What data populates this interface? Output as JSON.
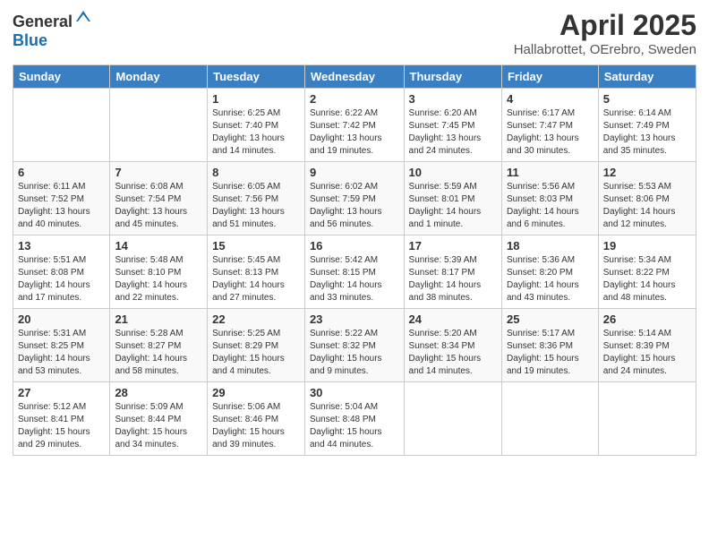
{
  "header": {
    "logo_general": "General",
    "logo_blue": "Blue",
    "title": "April 2025",
    "subtitle": "Hallabrottet, OErebro, Sweden"
  },
  "weekdays": [
    "Sunday",
    "Monday",
    "Tuesday",
    "Wednesday",
    "Thursday",
    "Friday",
    "Saturday"
  ],
  "weeks": [
    [
      {
        "num": "",
        "info": ""
      },
      {
        "num": "",
        "info": ""
      },
      {
        "num": "1",
        "info": "Sunrise: 6:25 AM\nSunset: 7:40 PM\nDaylight: 13 hours and 14 minutes."
      },
      {
        "num": "2",
        "info": "Sunrise: 6:22 AM\nSunset: 7:42 PM\nDaylight: 13 hours and 19 minutes."
      },
      {
        "num": "3",
        "info": "Sunrise: 6:20 AM\nSunset: 7:45 PM\nDaylight: 13 hours and 24 minutes."
      },
      {
        "num": "4",
        "info": "Sunrise: 6:17 AM\nSunset: 7:47 PM\nDaylight: 13 hours and 30 minutes."
      },
      {
        "num": "5",
        "info": "Sunrise: 6:14 AM\nSunset: 7:49 PM\nDaylight: 13 hours and 35 minutes."
      }
    ],
    [
      {
        "num": "6",
        "info": "Sunrise: 6:11 AM\nSunset: 7:52 PM\nDaylight: 13 hours and 40 minutes."
      },
      {
        "num": "7",
        "info": "Sunrise: 6:08 AM\nSunset: 7:54 PM\nDaylight: 13 hours and 45 minutes."
      },
      {
        "num": "8",
        "info": "Sunrise: 6:05 AM\nSunset: 7:56 PM\nDaylight: 13 hours and 51 minutes."
      },
      {
        "num": "9",
        "info": "Sunrise: 6:02 AM\nSunset: 7:59 PM\nDaylight: 13 hours and 56 minutes."
      },
      {
        "num": "10",
        "info": "Sunrise: 5:59 AM\nSunset: 8:01 PM\nDaylight: 14 hours and 1 minute."
      },
      {
        "num": "11",
        "info": "Sunrise: 5:56 AM\nSunset: 8:03 PM\nDaylight: 14 hours and 6 minutes."
      },
      {
        "num": "12",
        "info": "Sunrise: 5:53 AM\nSunset: 8:06 PM\nDaylight: 14 hours and 12 minutes."
      }
    ],
    [
      {
        "num": "13",
        "info": "Sunrise: 5:51 AM\nSunset: 8:08 PM\nDaylight: 14 hours and 17 minutes."
      },
      {
        "num": "14",
        "info": "Sunrise: 5:48 AM\nSunset: 8:10 PM\nDaylight: 14 hours and 22 minutes."
      },
      {
        "num": "15",
        "info": "Sunrise: 5:45 AM\nSunset: 8:13 PM\nDaylight: 14 hours and 27 minutes."
      },
      {
        "num": "16",
        "info": "Sunrise: 5:42 AM\nSunset: 8:15 PM\nDaylight: 14 hours and 33 minutes."
      },
      {
        "num": "17",
        "info": "Sunrise: 5:39 AM\nSunset: 8:17 PM\nDaylight: 14 hours and 38 minutes."
      },
      {
        "num": "18",
        "info": "Sunrise: 5:36 AM\nSunset: 8:20 PM\nDaylight: 14 hours and 43 minutes."
      },
      {
        "num": "19",
        "info": "Sunrise: 5:34 AM\nSunset: 8:22 PM\nDaylight: 14 hours and 48 minutes."
      }
    ],
    [
      {
        "num": "20",
        "info": "Sunrise: 5:31 AM\nSunset: 8:25 PM\nDaylight: 14 hours and 53 minutes."
      },
      {
        "num": "21",
        "info": "Sunrise: 5:28 AM\nSunset: 8:27 PM\nDaylight: 14 hours and 58 minutes."
      },
      {
        "num": "22",
        "info": "Sunrise: 5:25 AM\nSunset: 8:29 PM\nDaylight: 15 hours and 4 minutes."
      },
      {
        "num": "23",
        "info": "Sunrise: 5:22 AM\nSunset: 8:32 PM\nDaylight: 15 hours and 9 minutes."
      },
      {
        "num": "24",
        "info": "Sunrise: 5:20 AM\nSunset: 8:34 PM\nDaylight: 15 hours and 14 minutes."
      },
      {
        "num": "25",
        "info": "Sunrise: 5:17 AM\nSunset: 8:36 PM\nDaylight: 15 hours and 19 minutes."
      },
      {
        "num": "26",
        "info": "Sunrise: 5:14 AM\nSunset: 8:39 PM\nDaylight: 15 hours and 24 minutes."
      }
    ],
    [
      {
        "num": "27",
        "info": "Sunrise: 5:12 AM\nSunset: 8:41 PM\nDaylight: 15 hours and 29 minutes."
      },
      {
        "num": "28",
        "info": "Sunrise: 5:09 AM\nSunset: 8:44 PM\nDaylight: 15 hours and 34 minutes."
      },
      {
        "num": "29",
        "info": "Sunrise: 5:06 AM\nSunset: 8:46 PM\nDaylight: 15 hours and 39 minutes."
      },
      {
        "num": "30",
        "info": "Sunrise: 5:04 AM\nSunset: 8:48 PM\nDaylight: 15 hours and 44 minutes."
      },
      {
        "num": "",
        "info": ""
      },
      {
        "num": "",
        "info": ""
      },
      {
        "num": "",
        "info": ""
      }
    ]
  ]
}
